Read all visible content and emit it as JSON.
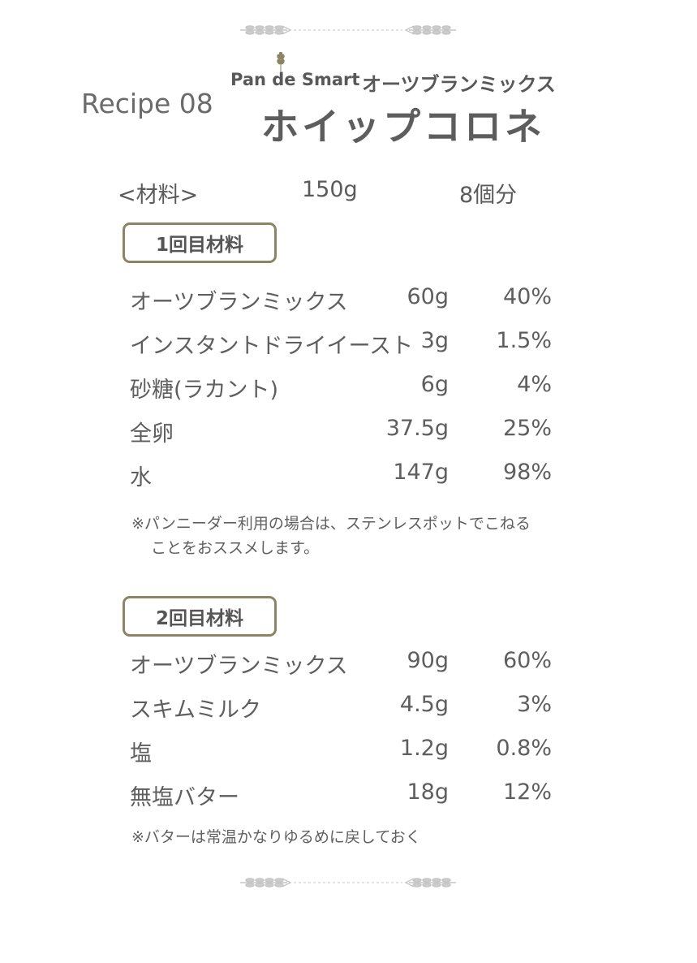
{
  "header": {
    "recipe_no": "Recipe 08",
    "brand_pan": "Pan",
    "brand_de": "de",
    "brand_smart": "Smart",
    "product": "オーツブランミックス",
    "title": "ホイップコロネ"
  },
  "meta": {
    "label": "<材料>",
    "flour": "150g",
    "yield": "8個分"
  },
  "section1": {
    "title": "1回目材料",
    "rows": [
      {
        "name": "オーツブランミックス",
        "amount": "60g",
        "percent": "40%"
      },
      {
        "name": "インスタントドライイースト",
        "amount": "3g",
        "percent": "1.5%"
      },
      {
        "name": "砂糖(ラカント)",
        "amount": "6g",
        "percent": "4%"
      },
      {
        "name": "全卵",
        "amount": "37.5g",
        "percent": "25%"
      },
      {
        "name": "水",
        "amount": "147g",
        "percent": "98%"
      }
    ],
    "note_line1": "※パンニーダー利用の場合は、ステンレスポットでこねる",
    "note_line2": "ことをおススメします。"
  },
  "section2": {
    "title": "2回目材料",
    "rows": [
      {
        "name": "オーツブランミックス",
        "amount": "90g",
        "percent": "60%"
      },
      {
        "name": "スキムミルク",
        "amount": "4.5g",
        "percent": "3%"
      },
      {
        "name": "塩",
        "amount": "1.2g",
        "percent": "0.8%"
      },
      {
        "name": "無塩バター",
        "amount": "18g",
        "percent": "12%"
      }
    ],
    "note": "※バターは常温かなりゆるめに戻しておく"
  },
  "colors": {
    "accent_border": "#8c8462",
    "text": "#5e5e5e",
    "ornament": "#c4c4c4"
  },
  "icons": {
    "ornament": "wheat-divider-icon",
    "brand": "wheat-sprig-icon"
  }
}
